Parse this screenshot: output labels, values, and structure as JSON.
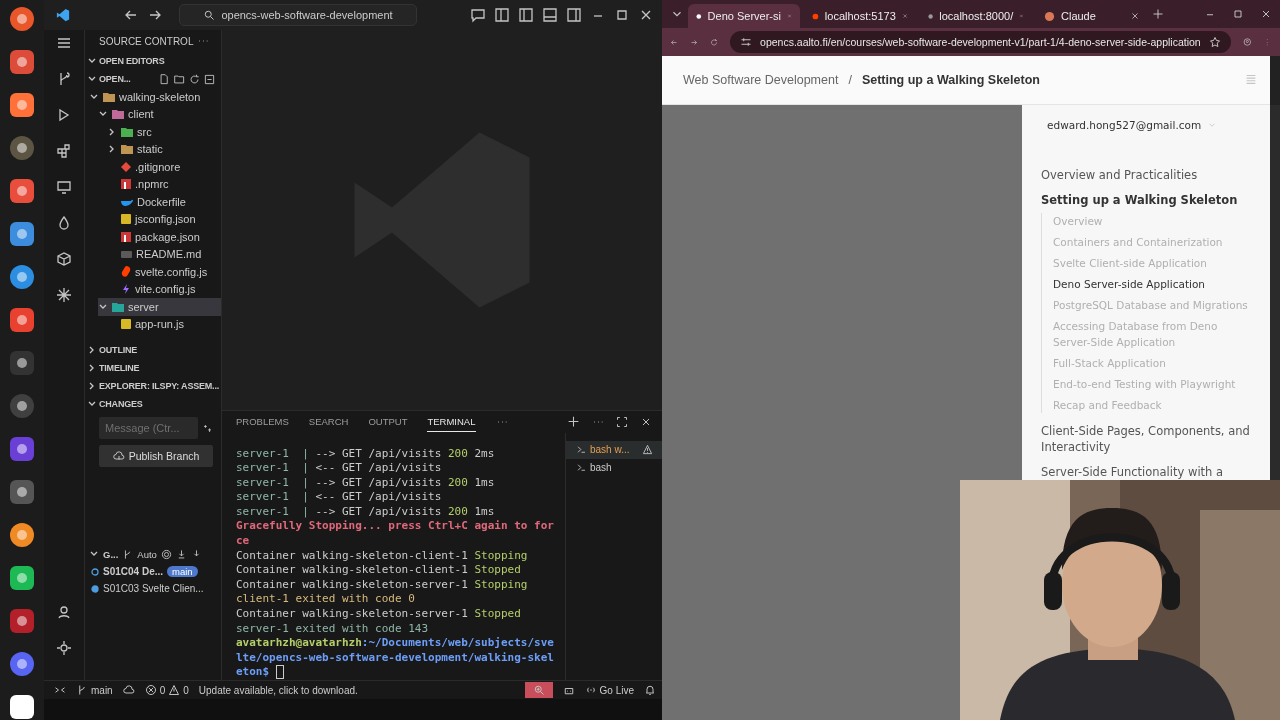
{
  "vscode": {
    "search": "opencs-web-software-development",
    "sidebar_title": "SOURCE CONTROL",
    "open_editors": {
      "label": "OPEN EDITORS",
      "expanded": true
    },
    "repo": {
      "label": "OPEN...",
      "expanded": true,
      "tree": [
        {
          "label": "walking-skeleton",
          "kind": "folder",
          "expanded": true,
          "selected": false,
          "children": [
            {
              "label": "client",
              "kind": "client",
              "expanded": true,
              "selected": false,
              "children": [
                {
                  "label": "src",
                  "kind": "src",
                  "expanded": false,
                  "selected": false
                },
                {
                  "label": "static",
                  "kind": "folder",
                  "expanded": false,
                  "selected": false
                },
                {
                  "label": ".gitignore",
                  "kind": "git",
                  "selected": false
                },
                {
                  "label": ".npmrc",
                  "kind": "npm",
                  "selected": false
                },
                {
                  "label": "Dockerfile",
                  "kind": "docker",
                  "selected": false
                },
                {
                  "label": "jsconfig.json",
                  "kind": "js",
                  "selected": false
                },
                {
                  "label": "package.json",
                  "kind": "npm",
                  "selected": false
                },
                {
                  "label": "README.md",
                  "kind": "md",
                  "selected": false
                },
                {
                  "label": "svelte.config.js",
                  "kind": "svelte",
                  "selected": false
                },
                {
                  "label": "vite.config.js",
                  "kind": "vite",
                  "selected": false
                }
              ]
            },
            {
              "label": "server",
              "kind": "server",
              "expanded": true,
              "selected": true,
              "children": [
                {
                  "label": "app-run.js",
                  "kind": "js",
                  "selected": false
                }
              ]
            }
          ]
        }
      ]
    },
    "sections": [
      {
        "label": "OUTLINE",
        "expanded": false
      },
      {
        "label": "TIMELINE",
        "expanded": false
      },
      {
        "label": "EXPLORER: ILSPY: ASSEM...",
        "expanded": false
      },
      {
        "label": "CHANGES",
        "expanded": true
      }
    ],
    "changes": {
      "placeholder": "Message (Ctr...",
      "button": "Publish Branch"
    },
    "graph": {
      "label": "G...",
      "expanded": true,
      "mode": "Auto",
      "commits": [
        {
          "message": "S01C04 De...",
          "branch": "main",
          "current": true
        },
        {
          "message": "S01C03 Svelte Clien...",
          "current": false
        }
      ]
    },
    "panel": {
      "tabs": [
        {
          "label": "PROBLEMS",
          "selected": false
        },
        {
          "label": "SEARCH",
          "selected": false
        },
        {
          "label": "OUTPUT",
          "selected": false
        },
        {
          "label": "TERMINAL",
          "selected": true
        }
      ],
      "lines": [
        [
          {
            "t": "server-1  | ",
            "kind": "service"
          },
          {
            "t": "--> GET /api/visits ",
            "kind": "plain"
          },
          {
            "t": "200",
            "kind": "num"
          },
          {
            "t": " 2ms",
            "kind": "plain"
          }
        ],
        [
          {
            "t": "server-1  | ",
            "kind": "service"
          },
          {
            "t": "<-- GET /api/visits",
            "kind": "plain"
          }
        ],
        [
          {
            "t": "server-1  | ",
            "kind": "service"
          },
          {
            "t": "--> GET /api/visits ",
            "kind": "plain"
          },
          {
            "t": "200",
            "kind": "num"
          },
          {
            "t": " 1ms",
            "kind": "plain"
          }
        ],
        [
          {
            "t": "server-1  | ",
            "kind": "service"
          },
          {
            "t": "<-- GET /api/visits",
            "kind": "plain"
          }
        ],
        [
          {
            "t": "server-1  | ",
            "kind": "service"
          },
          {
            "t": "--> GET /api/visits ",
            "kind": "plain"
          },
          {
            "t": "200",
            "kind": "num"
          },
          {
            "t": " 1ms",
            "kind": "plain"
          }
        ],
        [
          {
            "t": "Gracefully Stopping... press Ctrl+C again to for",
            "kind": "err"
          }
        ],
        [
          {
            "t": "ce",
            "kind": "err"
          }
        ],
        [
          {
            "t": "Container walking-skeleton-client-1 ",
            "kind": "plain"
          },
          {
            "t": "Stopping",
            "kind": "num"
          }
        ],
        [
          {
            "t": "Container walking-skeleton-client-1 ",
            "kind": "plain"
          },
          {
            "t": "Stopped",
            "kind": "num"
          }
        ],
        [
          {
            "t": "Container walking-skeleton-server-1 ",
            "kind": "plain"
          },
          {
            "t": "Stopping",
            "kind": "num"
          }
        ],
        [
          {
            "t": "client-1 exited with code 0",
            "kind": "warn"
          }
        ],
        [
          {
            "t": "Container walking-skeleton-server-1 ",
            "kind": "plain"
          },
          {
            "t": "Stopped",
            "kind": "num"
          }
        ],
        [
          {
            "t": "server-1 exited with code 143",
            "kind": "service"
          }
        ],
        [
          {
            "t": "avatarhzh@avatarhzh",
            "kind": "user"
          },
          {
            "t": ":~/Documents/web/subjects/sve",
            "kind": "path"
          }
        ],
        [
          {
            "t": "lte/opencs-web-software-development/walking-skel",
            "kind": "path"
          }
        ],
        [
          {
            "t": "eton$ ",
            "kind": "path"
          }
        ]
      ],
      "terminals": [
        {
          "label": "bash w...",
          "selected": true,
          "warning": true
        },
        {
          "label": "bash",
          "selected": false,
          "warning": false
        }
      ]
    },
    "status": {
      "branch": "main",
      "errors": "0",
      "warnings": "0",
      "message": "Update available, click to download.",
      "live": "Go Live"
    }
  },
  "browser": {
    "tabs": [
      {
        "title": "Deno Server-si",
        "selected": true
      },
      {
        "title": "localhost:5173",
        "selected": false
      },
      {
        "title": "localhost:8000/",
        "selected": false
      },
      {
        "title": "Claude",
        "selected": false
      }
    ],
    "url": "opencs.aalto.fi/en/courses/web-software-development-v1/part-1/4-deno-server-side-application",
    "breadcrumb": {
      "parent": "Web Software Development",
      "separator": "/",
      "current": "Setting up a Walking Skeleton"
    },
    "account": "edward.hong527@gmail.com",
    "chapters": [
      {
        "label": "Overview and Practicalities",
        "expanded": false
      },
      {
        "label": "Setting up a Walking Skeleton",
        "expanded": true,
        "children": [
          {
            "label": "Overview",
            "selected": false
          },
          {
            "label": "Containers and Containerization",
            "selected": false
          },
          {
            "label": "Svelte Client-side Application",
            "selected": false
          },
          {
            "label": "Deno Server-side Application",
            "selected": true
          },
          {
            "label": "PostgreSQL Database and Migrations",
            "selected": false
          },
          {
            "label": "Accessing Database from Deno Server-Side Application",
            "selected": false
          },
          {
            "label": "Full-Stack Application",
            "selected": false
          },
          {
            "label": "End-to-end Testing with Playwright",
            "selected": false
          },
          {
            "label": "Recap and Feedback",
            "selected": false
          }
        ]
      },
      {
        "label": "Client-Side Pages, Components, and Interactivity",
        "expanded": false
      },
      {
        "label": "Server-Side Functionality with a",
        "expanded": false
      }
    ]
  }
}
